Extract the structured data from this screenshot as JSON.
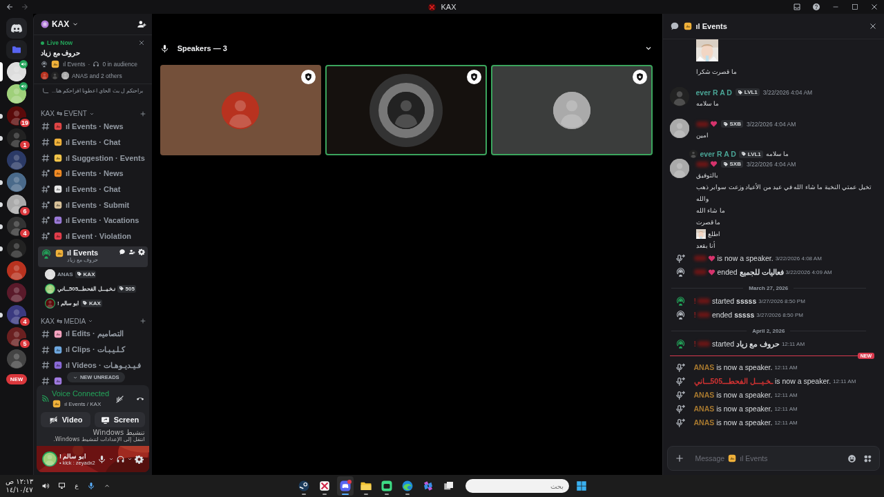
{
  "window": {
    "title": "KAX"
  },
  "servers": [
    {
      "kind": "home",
      "selected": false,
      "unread": false
    },
    {
      "kind": "folder",
      "selected": false,
      "unread": false
    },
    {
      "kind": "avatar",
      "selected": true,
      "unread": false,
      "voice": true
    },
    {
      "kind": "avatar",
      "selected": false,
      "unread": false,
      "voice": true
    },
    {
      "kind": "avatar",
      "selected": false,
      "unread": true,
      "badge": "19"
    },
    {
      "kind": "avatar",
      "selected": false,
      "unread": true,
      "badge": "1"
    },
    {
      "kind": "avatar",
      "selected": false,
      "unread": false
    },
    {
      "kind": "avatar",
      "selected": false,
      "unread": true
    },
    {
      "kind": "avatar",
      "selected": false,
      "unread": true,
      "badge": "6"
    },
    {
      "kind": "avatar",
      "selected": false,
      "unread": true,
      "badge": "4"
    },
    {
      "kind": "avatar",
      "selected": false,
      "unread": true
    },
    {
      "kind": "avatar",
      "selected": false,
      "unread": false
    },
    {
      "kind": "avatar",
      "selected": false,
      "unread": false
    },
    {
      "kind": "avatar",
      "selected": false,
      "unread": true,
      "badge": "4"
    },
    {
      "kind": "avatar",
      "selected": false,
      "unread": false,
      "badge": "5"
    },
    {
      "kind": "avatar",
      "selected": false,
      "unread": false
    }
  ],
  "servers_new_pill": "NEW",
  "server": {
    "name": "KAX"
  },
  "live": {
    "status": "Live Now",
    "title": "حروف مع زياد",
    "channel": "ıl Events",
    "separator": "·",
    "audience": "0 in audience",
    "participants": "ANAS and 2 others",
    "thread": "...براحتكم ل بث الحاي اعطونا افراحكم هنا"
  },
  "categories": [
    {
      "name": "KAX ⇆ EVENT",
      "channels": [
        {
          "kind": "text",
          "name": "ıl Events · News",
          "selected": false
        },
        {
          "kind": "text",
          "name": "ıl Events · Chat",
          "selected": false
        },
        {
          "kind": "text",
          "name": "ıl Suggestion · Events",
          "selected": false
        },
        {
          "kind": "limited",
          "name": "ıl Events · News",
          "selected": false
        },
        {
          "kind": "limited",
          "name": "ıl Events · Chat",
          "selected": false
        },
        {
          "kind": "limited",
          "name": "ıl Events · Submit",
          "selected": false
        },
        {
          "kind": "limited",
          "name": "ıl Events · Vacations",
          "selected": false
        },
        {
          "kind": "limited",
          "name": "ıl Event · Violation",
          "selected": false
        },
        {
          "kind": "stage",
          "name": "ıl Events",
          "subtitle": "حروف مع زياد",
          "selected": true,
          "members": [
            {
              "name": "ANAS",
              "tag": "KAX",
              "speaking": false
            },
            {
              "name": "نـخـيـــل الفحطـــ505ـــاني",
              "tag": "505",
              "speaking": true
            },
            {
              "name": "! ابو سالم",
              "tag": "KAX",
              "speaking": true
            }
          ]
        }
      ]
    },
    {
      "name": "KAX ⇆ MEDIA",
      "channels": [
        {
          "kind": "text",
          "name": "ıl Edits · التصاميم",
          "selected": false
        },
        {
          "kind": "text",
          "name": "ıl Clips · كـلـيـبـات",
          "selected": false
        },
        {
          "kind": "text",
          "name": "ıl Videos · فـيـديـوهـات",
          "selected": false
        },
        {
          "kind": "text",
          "selected": false
        }
      ]
    }
  ],
  "unreads_pill": "NEW UNREADS",
  "voice": {
    "status": "Voice Connected",
    "channel": "ıl Events / KAX",
    "buttons": [
      "Video",
      "Screen"
    ]
  },
  "user": {
    "name": "! ابو سالم",
    "status": "• kick : zeyadx2"
  },
  "activation": {
    "title": "تنشيط Windows",
    "text": "انتقل إلى الإعدادات لتنشيط Windows."
  },
  "stage": {
    "title": "Speakers — 3",
    "tiles": [
      {
        "color": "#74503a",
        "speaking": false,
        "pulse": false
      },
      {
        "color": "#15110e",
        "speaking": true,
        "pulse": true
      },
      {
        "color": "#3b3d3c",
        "speaking": true,
        "pulse": false
      }
    ]
  },
  "chat": {
    "title": "ıl Events",
    "messages": [
      {
        "kind": "continuation",
        "attachment": {
          "kind": "picture"
        },
        "lines": [
          {
            "text": "ما قصرت شكرا"
          }
        ]
      },
      {
        "kind": "message",
        "author": {
          "name": "ever R A D",
          "redacted": false,
          "color": "#4aa596"
        },
        "badge": "LVL1",
        "time": "3/22/2026 4:04 AM",
        "lines": [
          {
            "text": "ما سلامه"
          }
        ]
      },
      {
        "kind": "message",
        "author": {
          "redacted": true
        },
        "badge": "SXB",
        "time": "3/22/2026 4:04 AM",
        "lines": [
          {
            "text": "امين"
          }
        ]
      },
      {
        "kind": "message",
        "reply": {
          "author": {
            "name": "ever R A D",
            "redacted": false,
            "color": "#4aa596"
          },
          "badge": "LVL1",
          "text": "ما سلامه"
        },
        "author": {
          "redacted": true
        },
        "badge": "SXB",
        "time": "3/22/2026 4:04 AM",
        "lines": [
          {
            "text": "بالتوفيق"
          },
          {
            "text": "تخيل عمتي النخبة ما شاء الله في عيد من الأعياد وزعت سوابر ذهب"
          },
          {
            "text": "والله"
          },
          {
            "text": "ما شاء الله"
          },
          {
            "text": "ما قصرت"
          },
          {
            "text": "اطلع",
            "inline_picture": true
          },
          {
            "text": "أنا بقعد"
          }
        ]
      },
      {
        "kind": "speaker",
        "actor": {
          "redacted": true
        },
        "text": "is now a speaker.",
        "time": "3/22/2026 4:08 AM"
      },
      {
        "kind": "ended",
        "actor": {
          "redacted": true
        },
        "text": "ended **فعاليات للجميع**",
        "time": "3/22/2026 4:09 AM"
      },
      {
        "kind": "divider",
        "label": "March 27, 2026"
      },
      {
        "kind": "started",
        "actor": {
          "name": "!",
          "redacted": true,
          "color": "#8a2020"
        },
        "text": "started **sssss**",
        "time": "3/27/2026 8:50 PM"
      },
      {
        "kind": "ended",
        "actor": {
          "name": "!",
          "redacted": true,
          "color": "#8a2020"
        },
        "text": "ended **sssss**",
        "time": "3/27/2026 8:50 PM"
      },
      {
        "kind": "divider",
        "label": "April 2, 2026"
      },
      {
        "kind": "started",
        "actor": {
          "name": "!",
          "redacted": true,
          "color": "#8a2020"
        },
        "text": "started **حروف مع زياد**",
        "time": "12:11 AM"
      },
      {
        "kind": "new",
        "label": "NEW"
      },
      {
        "kind": "speaker",
        "actor": {
          "name": "ANAS",
          "redacted": false,
          "color": "#a8792f"
        },
        "text": "is now a speaker.",
        "time": "12:11 AM"
      },
      {
        "kind": "speaker",
        "actor": {
          "name": "ـخـيـــل الفحطـــ505ـــاني",
          "redacted": false,
          "color": "#d13232"
        },
        "text": "is now a speaker.",
        "time": "12:11 AM"
      },
      {
        "kind": "speaker",
        "actor": {
          "name": "ANAS",
          "redacted": false,
          "color": "#a8792f"
        },
        "text": "is now a speaker.",
        "time": "12:11 AM"
      },
      {
        "kind": "speaker",
        "actor": {
          "name": "ANAS",
          "redacted": false,
          "color": "#a8792f"
        },
        "text": "is now a speaker.",
        "time": "12:11 AM"
      },
      {
        "kind": "speaker",
        "actor": {
          "name": "ANAS",
          "redacted": false,
          "color": "#a8792f"
        },
        "text": "is now a speaker.",
        "time": "12:11 AM"
      }
    ],
    "composer": {
      "placeholder": "Message",
      "channel": "ıl Events"
    }
  },
  "taskbar": {
    "time": "١٢:١٣ ص",
    "date": "١٤/١٠/٤٧",
    "language": "ع",
    "search_placeholder": "بحث",
    "apps": [
      {
        "running": true,
        "selected": false
      },
      {
        "running": true,
        "selected": false
      },
      {
        "running": true,
        "selected": true
      },
      {
        "running": true,
        "selected": false
      },
      {
        "running": true,
        "selected": false
      },
      {
        "running": true,
        "selected": false
      },
      {
        "running": false,
        "selected": false
      },
      {
        "running": false,
        "selected": false
      }
    ]
  }
}
